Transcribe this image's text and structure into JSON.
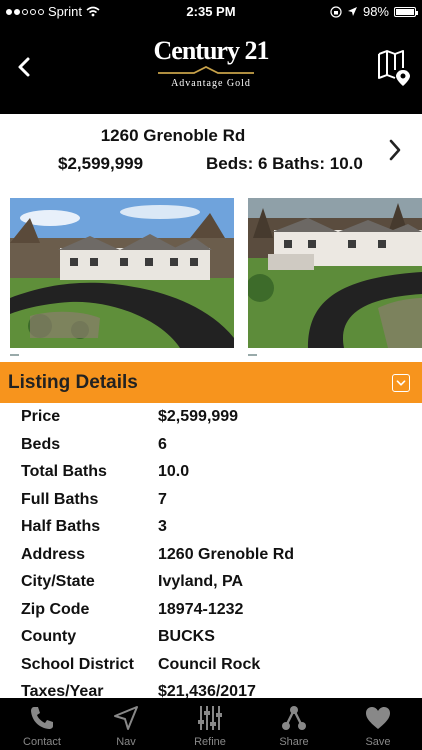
{
  "status": {
    "carrier": "Sprint",
    "time": "2:35 PM",
    "battery": "98%",
    "battery_level": 0.98
  },
  "logo": {
    "brand": "Century 21",
    "sub": "Advantage Gold"
  },
  "listing": {
    "address": "1260 Grenoble Rd",
    "price": "$2,599,999",
    "beds_baths": "Beds: 6  Baths: 10.0"
  },
  "section": {
    "title": "Listing Details"
  },
  "details": [
    {
      "label": "Price",
      "value": "$2,599,999"
    },
    {
      "label": "Beds",
      "value": "6"
    },
    {
      "label": "Total Baths",
      "value": "10.0"
    },
    {
      "label": "Full Baths",
      "value": "7"
    },
    {
      "label": "Half Baths",
      "value": "3"
    },
    {
      "label": "Address",
      "value": "1260 Grenoble Rd"
    },
    {
      "label": "City/State",
      "value": "Ivyland, PA"
    },
    {
      "label": "Zip Code",
      "value": "18974-1232"
    },
    {
      "label": "County",
      "value": "BUCKS"
    },
    {
      "label": "School District",
      "value": "Council Rock"
    },
    {
      "label": "Taxes/Year",
      "value": "$21,436/2017"
    }
  ],
  "tabs": [
    {
      "label": "Contact",
      "icon": "phone-icon"
    },
    {
      "label": "Nav",
      "icon": "navigation-arrow-icon"
    },
    {
      "label": "Refine",
      "icon": "sliders-icon"
    },
    {
      "label": "Share",
      "icon": "share-icon"
    },
    {
      "label": "Save",
      "icon": "heart-icon"
    }
  ],
  "colors": {
    "accent": "#F7941D",
    "bar": "#000000",
    "tab_inactive": "#888888"
  }
}
